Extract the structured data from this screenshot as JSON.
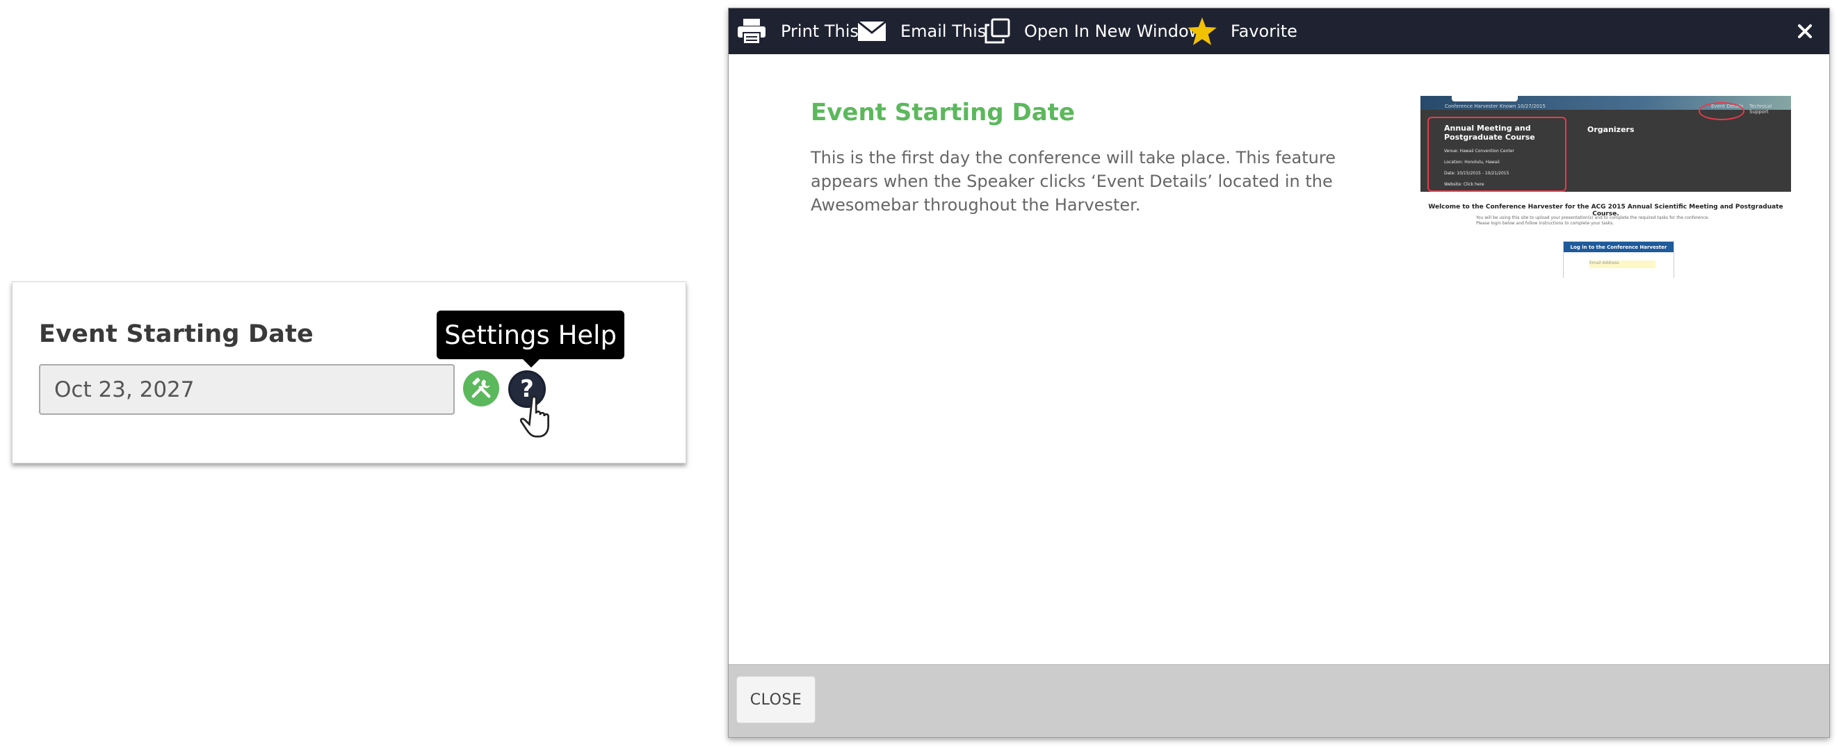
{
  "field": {
    "label": "Event Starting Date",
    "value": "Oct 23, 2027",
    "tooltip": "Settings Help"
  },
  "help_window": {
    "toolbar": {
      "print": "Print This",
      "email": "Email This",
      "open_new": "Open In New Window",
      "favorite": "Favorite"
    },
    "title": "Event Starting Date",
    "body": "This is the first day the conference will take place. This feature appears when the Speaker clicks ‘Event Details’ located in the Awesomebar throughout the Harvester.",
    "close_label": "CLOSE"
  },
  "thumbnail": {
    "nav_left": "Conference Harvester Known 10/27/2015",
    "nav_event": "Event Details",
    "nav_support": "Technical Support",
    "heading": "Annual Meeting and Postgraduate Course",
    "venue": "Venue: Hawaii Convention Center",
    "location": "Location: Honolulu, Hawaii",
    "dates": "Date: 10/15/2015 - 10/21/2015",
    "website": "Website: Click here",
    "organizers": "Organizers",
    "welcome": "Welcome to the Conference Harvester for the ACG 2015 Annual Scientific Meeting and Postgraduate Course.",
    "sub1": "You will be using this site to upload your presentation(s) and to complete the required tasks for the conference.",
    "sub2": "Please login below and follow instructions to complete your tasks.",
    "login_head": "Log in to the Conference Harvester",
    "login_field": "Email Address"
  },
  "colors": {
    "accent_green": "#5cb85c",
    "toolbar_bg": "#1f2231",
    "favorite_star": "#f2c100"
  }
}
